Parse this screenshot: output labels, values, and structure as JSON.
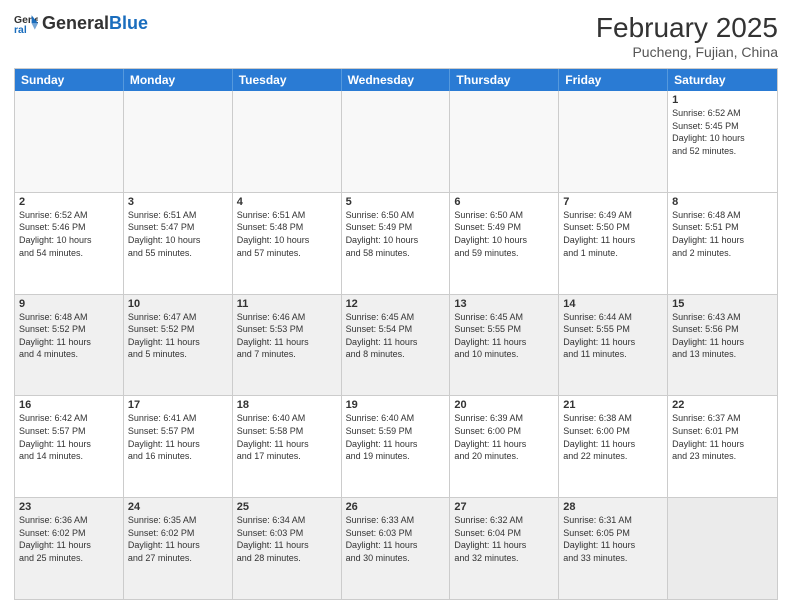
{
  "header": {
    "logo": {
      "general": "General",
      "blue": "Blue"
    },
    "month": "February 2025",
    "location": "Pucheng, Fujian, China"
  },
  "weekdays": [
    "Sunday",
    "Monday",
    "Tuesday",
    "Wednesday",
    "Thursday",
    "Friday",
    "Saturday"
  ],
  "rows": [
    {
      "alt": false,
      "cells": [
        {
          "day": "",
          "info": ""
        },
        {
          "day": "",
          "info": ""
        },
        {
          "day": "",
          "info": ""
        },
        {
          "day": "",
          "info": ""
        },
        {
          "day": "",
          "info": ""
        },
        {
          "day": "",
          "info": ""
        },
        {
          "day": "1",
          "info": "Sunrise: 6:52 AM\nSunset: 5:45 PM\nDaylight: 10 hours\nand 52 minutes."
        }
      ]
    },
    {
      "alt": false,
      "cells": [
        {
          "day": "2",
          "info": "Sunrise: 6:52 AM\nSunset: 5:46 PM\nDaylight: 10 hours\nand 54 minutes."
        },
        {
          "day": "3",
          "info": "Sunrise: 6:51 AM\nSunset: 5:47 PM\nDaylight: 10 hours\nand 55 minutes."
        },
        {
          "day": "4",
          "info": "Sunrise: 6:51 AM\nSunset: 5:48 PM\nDaylight: 10 hours\nand 57 minutes."
        },
        {
          "day": "5",
          "info": "Sunrise: 6:50 AM\nSunset: 5:49 PM\nDaylight: 10 hours\nand 58 minutes."
        },
        {
          "day": "6",
          "info": "Sunrise: 6:50 AM\nSunset: 5:49 PM\nDaylight: 10 hours\nand 59 minutes."
        },
        {
          "day": "7",
          "info": "Sunrise: 6:49 AM\nSunset: 5:50 PM\nDaylight: 11 hours\nand 1 minute."
        },
        {
          "day": "8",
          "info": "Sunrise: 6:48 AM\nSunset: 5:51 PM\nDaylight: 11 hours\nand 2 minutes."
        }
      ]
    },
    {
      "alt": true,
      "cells": [
        {
          "day": "9",
          "info": "Sunrise: 6:48 AM\nSunset: 5:52 PM\nDaylight: 11 hours\nand 4 minutes."
        },
        {
          "day": "10",
          "info": "Sunrise: 6:47 AM\nSunset: 5:52 PM\nDaylight: 11 hours\nand 5 minutes."
        },
        {
          "day": "11",
          "info": "Sunrise: 6:46 AM\nSunset: 5:53 PM\nDaylight: 11 hours\nand 7 minutes."
        },
        {
          "day": "12",
          "info": "Sunrise: 6:45 AM\nSunset: 5:54 PM\nDaylight: 11 hours\nand 8 minutes."
        },
        {
          "day": "13",
          "info": "Sunrise: 6:45 AM\nSunset: 5:55 PM\nDaylight: 11 hours\nand 10 minutes."
        },
        {
          "day": "14",
          "info": "Sunrise: 6:44 AM\nSunset: 5:55 PM\nDaylight: 11 hours\nand 11 minutes."
        },
        {
          "day": "15",
          "info": "Sunrise: 6:43 AM\nSunset: 5:56 PM\nDaylight: 11 hours\nand 13 minutes."
        }
      ]
    },
    {
      "alt": false,
      "cells": [
        {
          "day": "16",
          "info": "Sunrise: 6:42 AM\nSunset: 5:57 PM\nDaylight: 11 hours\nand 14 minutes."
        },
        {
          "day": "17",
          "info": "Sunrise: 6:41 AM\nSunset: 5:57 PM\nDaylight: 11 hours\nand 16 minutes."
        },
        {
          "day": "18",
          "info": "Sunrise: 6:40 AM\nSunset: 5:58 PM\nDaylight: 11 hours\nand 17 minutes."
        },
        {
          "day": "19",
          "info": "Sunrise: 6:40 AM\nSunset: 5:59 PM\nDaylight: 11 hours\nand 19 minutes."
        },
        {
          "day": "20",
          "info": "Sunrise: 6:39 AM\nSunset: 6:00 PM\nDaylight: 11 hours\nand 20 minutes."
        },
        {
          "day": "21",
          "info": "Sunrise: 6:38 AM\nSunset: 6:00 PM\nDaylight: 11 hours\nand 22 minutes."
        },
        {
          "day": "22",
          "info": "Sunrise: 6:37 AM\nSunset: 6:01 PM\nDaylight: 11 hours\nand 23 minutes."
        }
      ]
    },
    {
      "alt": true,
      "cells": [
        {
          "day": "23",
          "info": "Sunrise: 6:36 AM\nSunset: 6:02 PM\nDaylight: 11 hours\nand 25 minutes."
        },
        {
          "day": "24",
          "info": "Sunrise: 6:35 AM\nSunset: 6:02 PM\nDaylight: 11 hours\nand 27 minutes."
        },
        {
          "day": "25",
          "info": "Sunrise: 6:34 AM\nSunset: 6:03 PM\nDaylight: 11 hours\nand 28 minutes."
        },
        {
          "day": "26",
          "info": "Sunrise: 6:33 AM\nSunset: 6:03 PM\nDaylight: 11 hours\nand 30 minutes."
        },
        {
          "day": "27",
          "info": "Sunrise: 6:32 AM\nSunset: 6:04 PM\nDaylight: 11 hours\nand 32 minutes."
        },
        {
          "day": "28",
          "info": "Sunrise: 6:31 AM\nSunset: 6:05 PM\nDaylight: 11 hours\nand 33 minutes."
        },
        {
          "day": "",
          "info": ""
        }
      ]
    }
  ]
}
